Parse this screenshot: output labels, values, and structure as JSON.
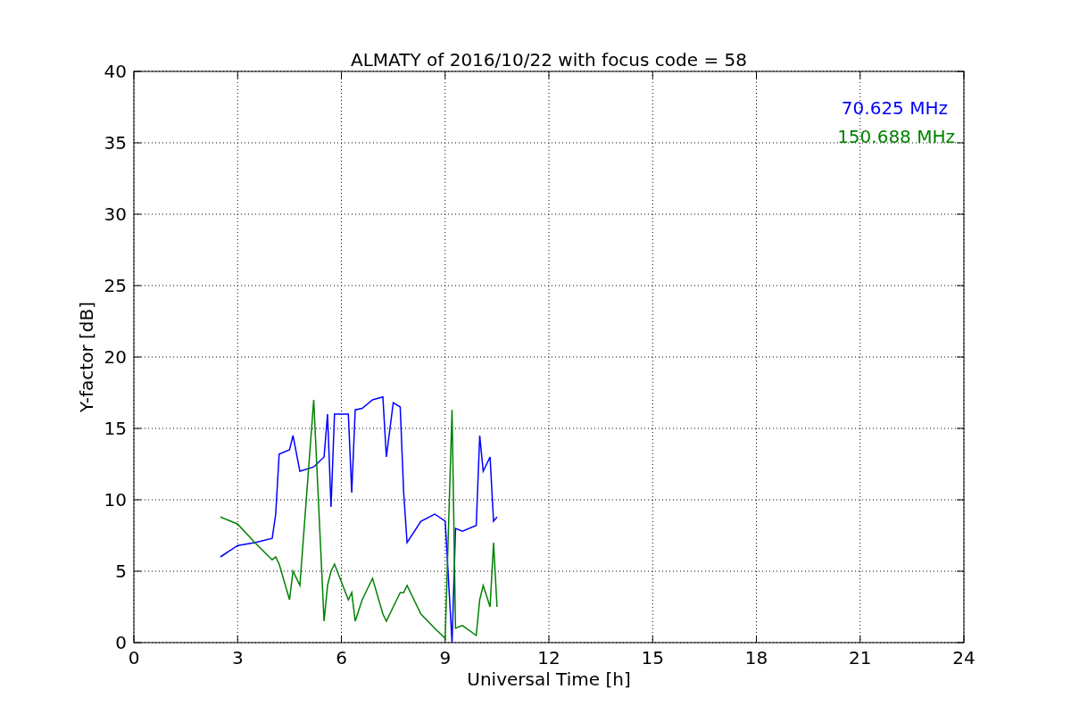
{
  "figure": {
    "chart_data": {
      "type": "line",
      "title": "ALMATY of 2016/10/22 with focus code = 58",
      "xlabel": "Universal Time [h]",
      "ylabel": "Y-factor [dB]",
      "x": [
        2.5,
        3,
        3.5,
        4,
        4.1,
        4.2,
        4.5,
        4.6,
        4.8,
        5.2,
        5.5,
        5.6,
        5.7,
        5.8,
        6.2,
        6.3,
        6.4,
        6.6,
        6.9,
        7.2,
        7.3,
        7.5,
        7.7,
        7.8,
        7.9,
        8.3,
        8.7,
        9,
        9.2,
        9.3,
        9.5,
        9.9,
        10,
        10.1,
        10.3,
        10.4,
        10.5
      ],
      "series": [
        {
          "name": "70.625 MHz",
          "color": "#0000ff",
          "values": [
            6,
            6.8,
            7,
            7.3,
            9,
            13.2,
            13.5,
            14.5,
            12,
            12.3,
            13,
            16,
            9.5,
            16,
            16,
            10.5,
            16.3,
            16.4,
            17,
            17.2,
            13,
            16.8,
            16.5,
            10.5,
            7,
            8.5,
            9,
            8.5,
            0,
            8,
            7.8,
            8.2,
            14.5,
            12,
            13,
            8.5,
            8.8
          ]
        },
        {
          "name": "150.688 MHz",
          "color": "#008000",
          "values": [
            8.8,
            8.3,
            7,
            5.8,
            6,
            5.5,
            3,
            5,
            4,
            17,
            1.5,
            4,
            5,
            5.5,
            3,
            3.5,
            1.5,
            3,
            4.5,
            2,
            1.5,
            2.5,
            3.5,
            3.5,
            4,
            2,
            1,
            0.3,
            16.3,
            1,
            1.2,
            0.5,
            3,
            4,
            2.5,
            7,
            2.5
          ]
        }
      ],
      "xlim": [
        0,
        24
      ],
      "ylim": [
        0,
        40
      ],
      "xticks": [
        0,
        3,
        6,
        9,
        12,
        15,
        18,
        21,
        24
      ],
      "yticks": [
        0,
        5,
        10,
        15,
        20,
        25,
        30,
        35,
        40
      ],
      "grid": true
    }
  }
}
